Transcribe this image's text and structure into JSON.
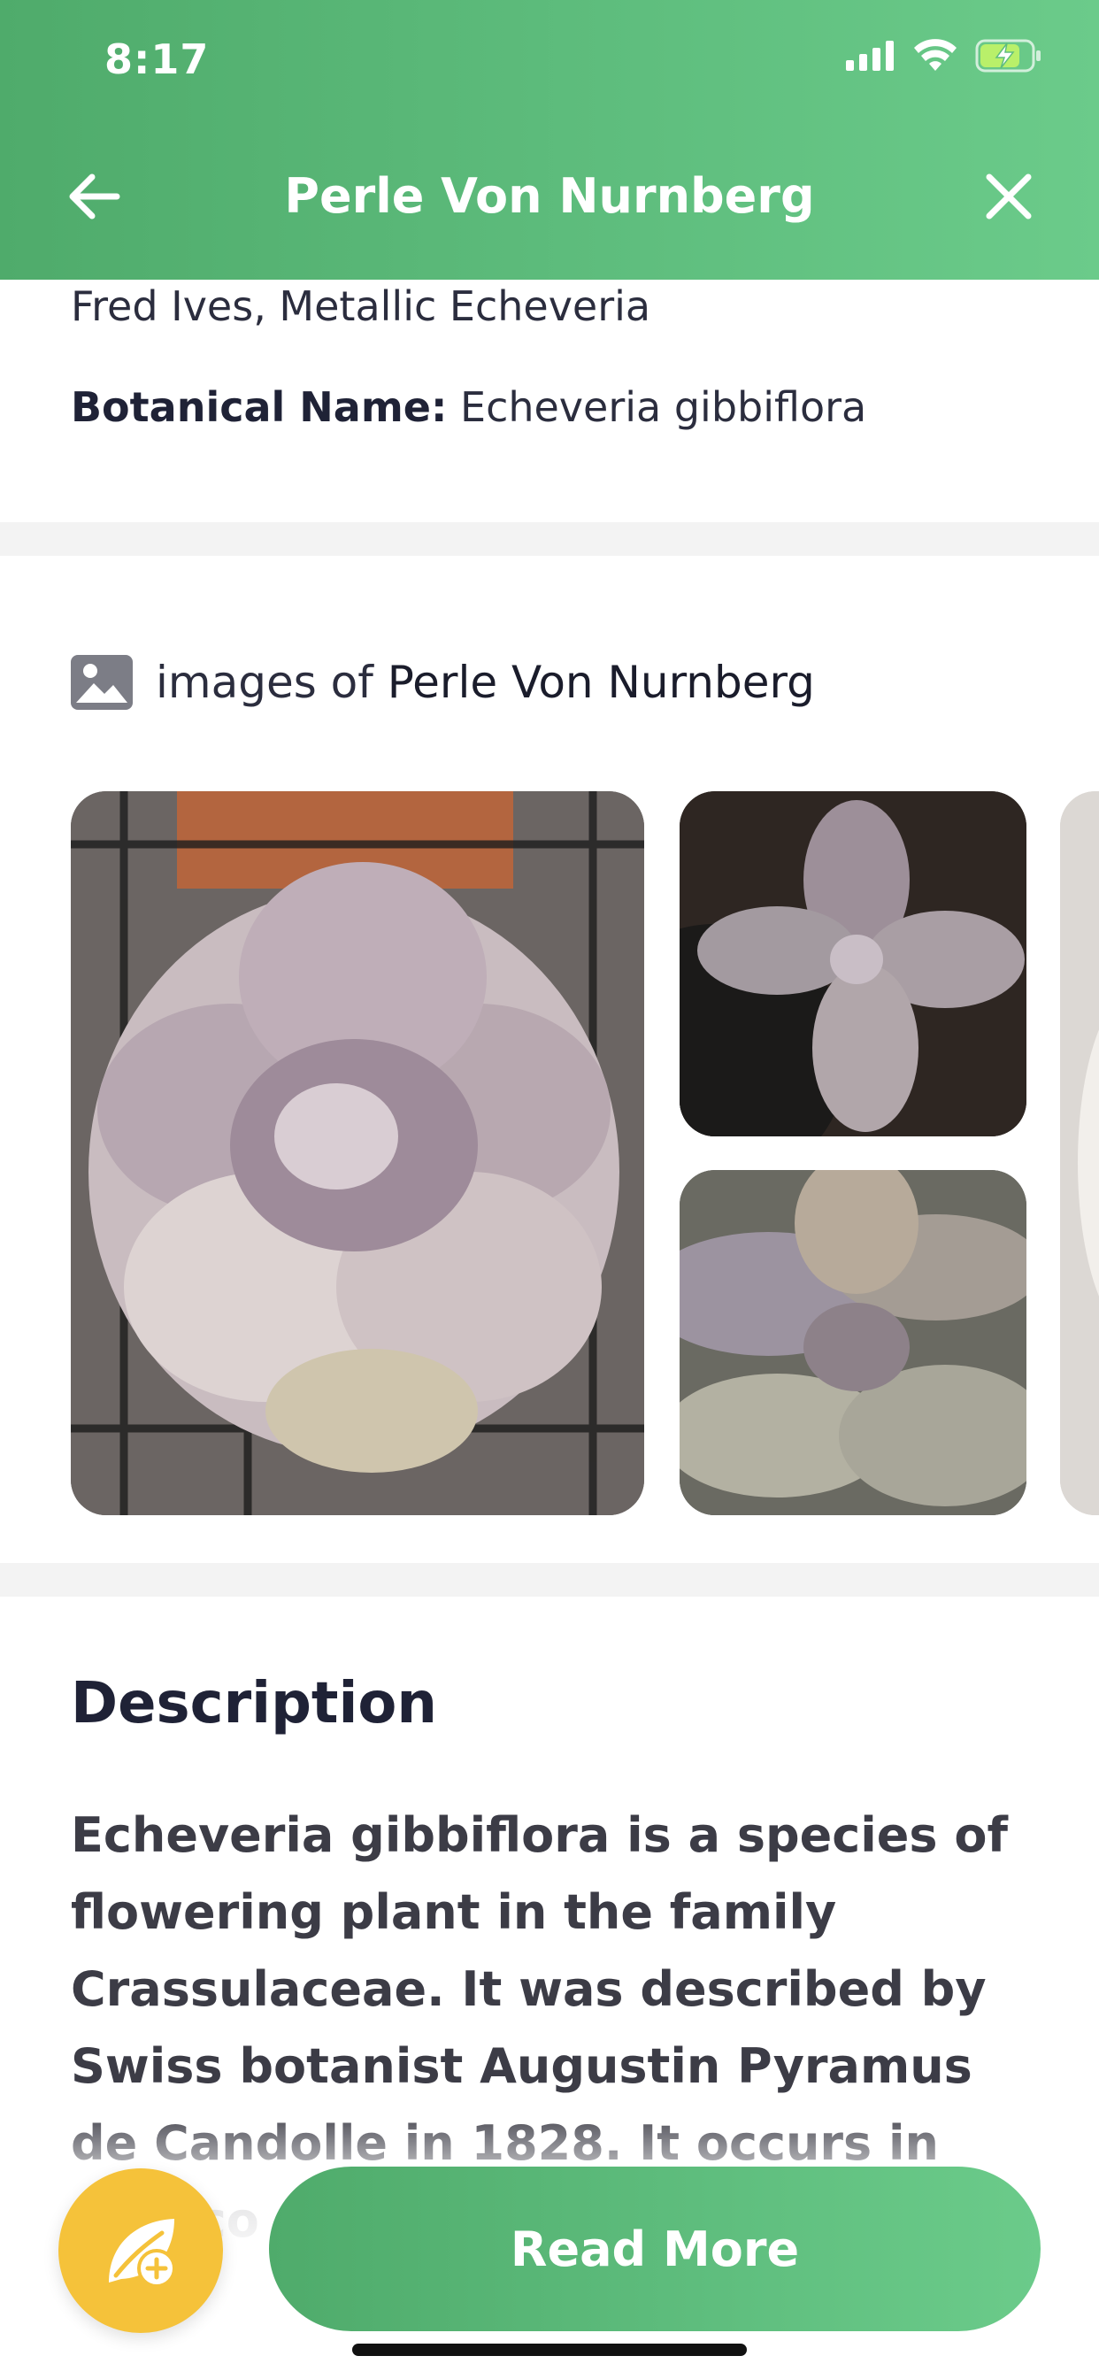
{
  "status_bar": {
    "time": "8:17"
  },
  "header": {
    "title": "Perle Von Nurnberg"
  },
  "names": {
    "common_names_tail": "Fred Ives, Metallic Echeveria",
    "botanical_label": "Botanical Name:",
    "botanical_value": "Echeveria gibbiflora"
  },
  "images": {
    "prefix": "images of",
    "plant_name": "Perle Von Nurnberg"
  },
  "description": {
    "title": "Description",
    "text": "Echeveria gibbiflora is a species of flowering plant in the family Crassulaceae. It was described by Swiss botanist Augustin Pyramus de Candolle in 1828. It occurs in Mexico"
  },
  "actions": {
    "read_more": "Read More"
  },
  "colors": {
    "primary_green": "#5ebd7d",
    "fab_yellow": "#f5c23a",
    "text_dark": "#1f2236"
  }
}
